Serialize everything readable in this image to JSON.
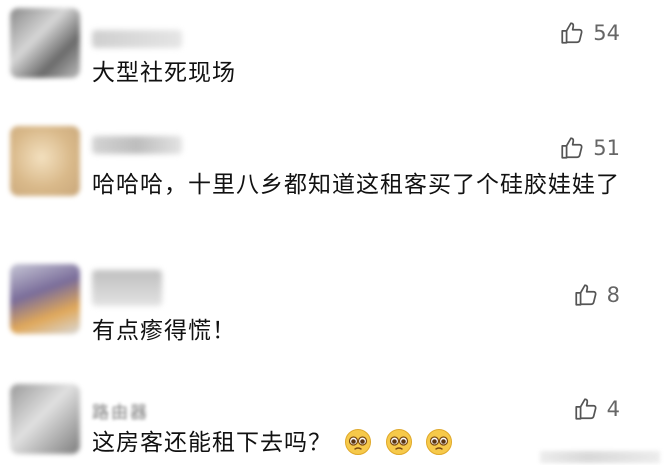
{
  "comments": [
    {
      "name": "",
      "likes": "54",
      "text": "大型社死现场"
    },
    {
      "name": "",
      "likes": "51",
      "text": "哈哈哈，十里八乡都知道这租客买了个硅胶娃娃了"
    },
    {
      "name": "",
      "likes": "8",
      "text": "有点瘆得慌！"
    },
    {
      "name": "路由器",
      "likes": "4",
      "text": "这房客还能租下去吗？"
    }
  ],
  "icons": {
    "like": "thumbs-up-icon",
    "emoji": "pleading-face-icon"
  },
  "colors": {
    "text": "#111111",
    "meta": "#666666",
    "divider": "#ececec"
  }
}
